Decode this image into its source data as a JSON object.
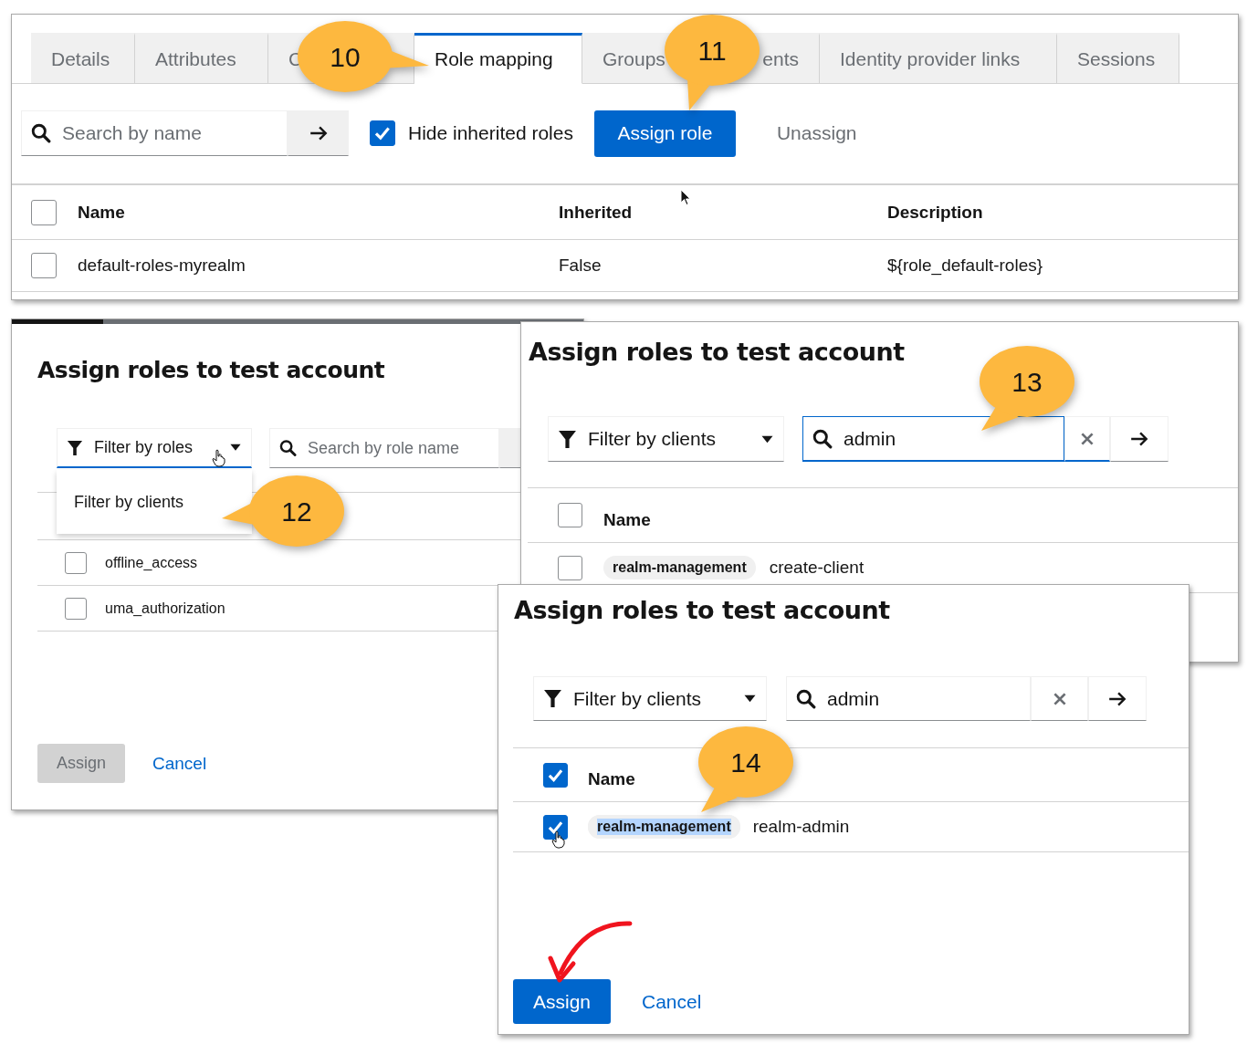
{
  "user_panel": {
    "tabs": [
      {
        "label": "Details",
        "selected": false
      },
      {
        "label": "Attributes",
        "selected": false
      },
      {
        "label": "C",
        "selected": false
      },
      {
        "label": "Role mapping",
        "selected": true
      },
      {
        "label": "Groups",
        "label_end": "ents",
        "selected": false
      },
      {
        "label": "Identity provider links",
        "selected": false
      },
      {
        "label": "Sessions",
        "selected": false
      }
    ],
    "search": {
      "placeholder": "Search by name"
    },
    "hide_inherited": {
      "label": "Hide inherited roles",
      "checked": true
    },
    "assign_button": "Assign role",
    "unassign_button": "Unassign",
    "table": {
      "columns": [
        "Name",
        "Inherited",
        "Description"
      ],
      "header_checked": false,
      "rows": [
        {
          "cells": [
            "default-roles-myrealm",
            "False",
            "${role_default-roles}"
          ],
          "checked": false
        }
      ]
    }
  },
  "dialog_filter_roles": {
    "progress": {
      "level": 0.16
    },
    "title": "Assign roles to test account",
    "filter": {
      "label": "Filter by roles",
      "open": true
    },
    "filter_menu": [
      "Filter by clients"
    ],
    "search": {
      "placeholder": "Search by role name"
    },
    "rows": [
      {
        "name": "offline_access",
        "checked": false
      },
      {
        "name": "uma_authorization",
        "checked": false
      }
    ],
    "assign_button": {
      "label": "Assign",
      "disabled": true
    },
    "cancel_button": "Cancel"
  },
  "dialog_search": {
    "title": "Assign roles to test account",
    "filter": {
      "label": "Filter by clients",
      "open": false
    },
    "search": {
      "value": "admin",
      "focused": true
    },
    "table": {
      "column": "Name",
      "header_checked": false,
      "rows": [
        {
          "client": "realm-management",
          "role": "create-client",
          "checked": false,
          "client_highlighted": false
        }
      ]
    }
  },
  "dialog_selected": {
    "title": "Assign roles to test account",
    "filter": {
      "label": "Filter by clients",
      "open": false
    },
    "search": {
      "value": "admin",
      "focused": false
    },
    "table": {
      "column": "Name",
      "header_checked": true,
      "rows": [
        {
          "client": "realm-management",
          "role": "realm-admin",
          "checked": true,
          "client_highlighted": true
        }
      ]
    },
    "assign_button": {
      "label": "Assign",
      "disabled": false
    },
    "cancel_button": "Cancel"
  },
  "callouts": [
    {
      "number": "10"
    },
    {
      "number": "11"
    },
    {
      "number": "12"
    },
    {
      "number": "13"
    },
    {
      "number": "14"
    }
  ]
}
